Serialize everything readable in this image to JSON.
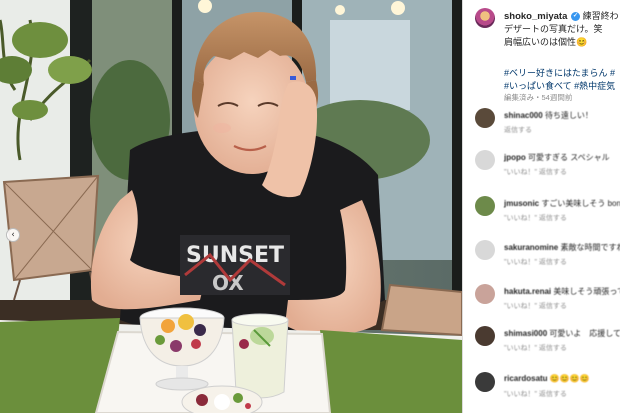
{
  "post": {
    "username": "shoko_miyata",
    "verified_icon": "✓",
    "caption_first": "練習終わり",
    "caption_line2": "デザートの写真だけ。笑",
    "caption_line3": "肩幅広いのは個性😊",
    "hashtag_line1": "#ベリー好きにはたまらん #",
    "hashtag_line2": "#いっぱい食べて #熱中症気",
    "meta": "編集済み・54週間前"
  },
  "photo": {
    "shirt_text_line1": "SUNSET",
    "shirt_text_line2": "OX"
  },
  "carousel": {
    "prev_icon": "‹"
  },
  "comments": [
    {
      "user": "shinac000",
      "text": "待ち遠しい！",
      "reply": "返信する",
      "avatar_color": "#5a4a3a"
    },
    {
      "user": "jpopo",
      "text": "可愛すぎる スペシャル",
      "reply": "\"いいね！\" 返信する",
      "avatar_color": "#d8d8d8"
    },
    {
      "user": "jmusonic",
      "text": "すごい美味しそう bon ap",
      "reply": "\"いいね！\" 返信する",
      "avatar_color": "#6d8a4a"
    },
    {
      "user": "sakuranomine",
      "text": "素敵な時間ですね",
      "reply": "\"いいね！\" 返信する",
      "avatar_color": "#d8d8d8"
    },
    {
      "user": "hakuta.renai",
      "text": "美味しそう頑張って",
      "reply": "\"いいね！\" 返信する",
      "avatar_color": "#c9a39a"
    },
    {
      "user": "shimasi000",
      "text": "可愛いよ　応援してます",
      "reply": "\"いいね！\" 返信する",
      "avatar_color": "#4a3a30"
    },
    {
      "user": "ricardosatu",
      "text": "😊😊😊😊",
      "reply": "\"いいね！\" 返信する",
      "avatar_color": "#3a3a3a"
    }
  ]
}
